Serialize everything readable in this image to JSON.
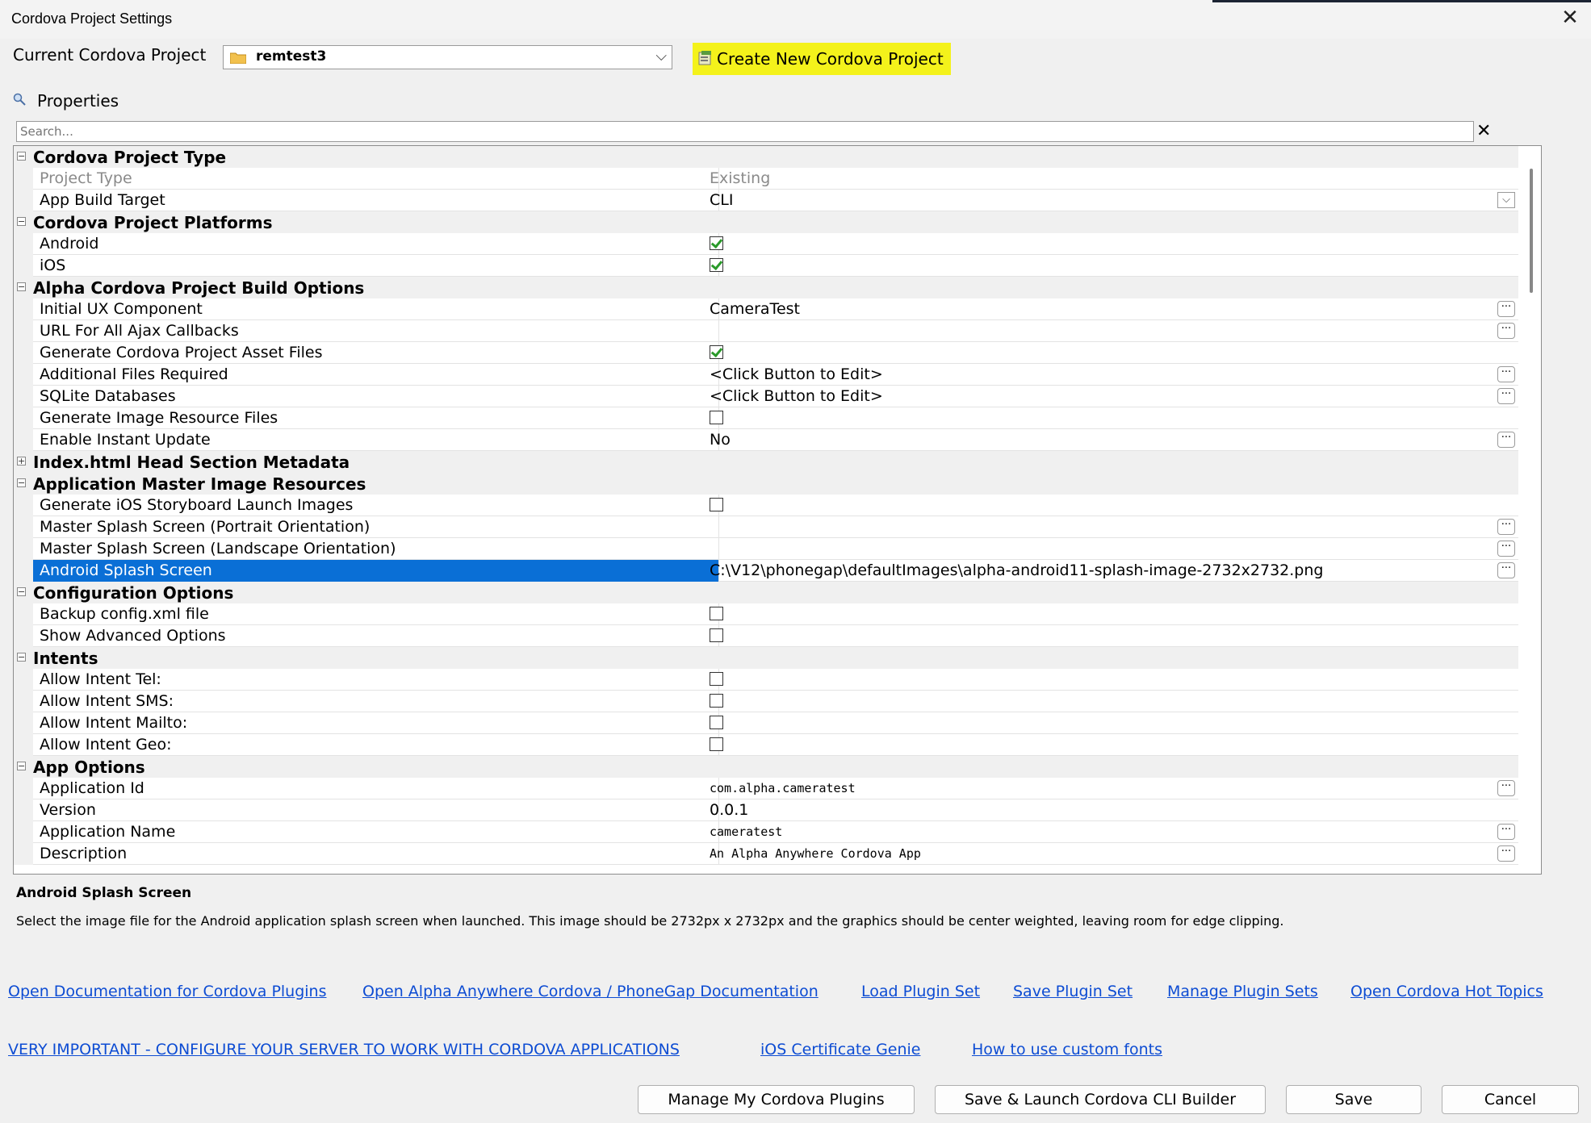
{
  "window": {
    "title": "Cordova Project Settings"
  },
  "project": {
    "label": "Current Cordova Project",
    "selected": "remtest3",
    "create_button": "Create New Cordova Project"
  },
  "properties": {
    "heading": "Properties",
    "search_placeholder": "Search..."
  },
  "grid": {
    "rows": [
      {
        "type": "cat",
        "name": "Cordova Project Type",
        "expanded": true
      },
      {
        "type": "prop",
        "name": "Project Type",
        "value": "Existing",
        "dim": true
      },
      {
        "type": "prop",
        "name": "App Build Target",
        "value": "CLI",
        "dropdown": true
      },
      {
        "type": "cat",
        "name": "Cordova Project Platforms",
        "expanded": true
      },
      {
        "type": "prop",
        "name": "Android",
        "check": true,
        "checked": true
      },
      {
        "type": "prop",
        "name": "iOS",
        "check": true,
        "checked": true
      },
      {
        "type": "cat",
        "name": "Alpha Cordova Project Build Options",
        "expanded": true
      },
      {
        "type": "prop",
        "name": "Initial UX Component",
        "value": "CameraTest",
        "ellipsis": true
      },
      {
        "type": "prop",
        "name": "URL For All Ajax Callbacks",
        "value": "",
        "ellipsis": true
      },
      {
        "type": "prop",
        "name": "Generate Cordova Project Asset Files",
        "check": true,
        "checked": true
      },
      {
        "type": "prop",
        "name": "Additional Files Required",
        "value": "<Click Button to Edit>",
        "ellipsis": true
      },
      {
        "type": "prop",
        "name": "SQLite Databases",
        "value": "<Click Button to Edit>",
        "ellipsis": true
      },
      {
        "type": "prop",
        "name": "Generate Image Resource Files",
        "check": true,
        "checked": false
      },
      {
        "type": "prop",
        "name": "Enable Instant Update",
        "value": "No",
        "ellipsis": true
      },
      {
        "type": "cat",
        "name": "Index.html Head Section Metadata",
        "expanded": false
      },
      {
        "type": "cat",
        "name": "Application Master Image Resources",
        "expanded": true
      },
      {
        "type": "prop",
        "name": "Generate iOS Storyboard Launch Images",
        "check": true,
        "checked": false
      },
      {
        "type": "prop",
        "name": "Master Splash Screen (Portrait Orientation)",
        "value": "",
        "ellipsis": true
      },
      {
        "type": "prop",
        "name": "Master Splash Screen (Landscape Orientation)",
        "value": "",
        "ellipsis": true
      },
      {
        "type": "prop",
        "name": "Android Splash Screen",
        "value": "C:\\V12\\phonegap\\defaultImages\\alpha-android11-splash-image-2732x2732.png",
        "ellipsis": true,
        "selected": true
      },
      {
        "type": "cat",
        "name": "Configuration Options",
        "expanded": true
      },
      {
        "type": "prop",
        "name": "Backup config.xml file",
        "check": true,
        "checked": false
      },
      {
        "type": "prop",
        "name": "Show Advanced Options",
        "check": true,
        "checked": false
      },
      {
        "type": "cat",
        "name": "Intents",
        "expanded": true
      },
      {
        "type": "prop",
        "name": "Allow Intent Tel:",
        "check": true,
        "checked": false
      },
      {
        "type": "prop",
        "name": "Allow Intent SMS:",
        "check": true,
        "checked": false
      },
      {
        "type": "prop",
        "name": "Allow Intent Mailto:",
        "check": true,
        "checked": false
      },
      {
        "type": "prop",
        "name": "Allow Intent Geo:",
        "check": true,
        "checked": false
      },
      {
        "type": "cat",
        "name": "App Options",
        "expanded": true
      },
      {
        "type": "prop",
        "name": "Application Id",
        "value": "com.alpha.cameratest",
        "ellipsis": true,
        "mono": true
      },
      {
        "type": "prop",
        "name": "Version",
        "value": "0.0.1"
      },
      {
        "type": "prop",
        "name": "Application Name",
        "value": "cameratest",
        "ellipsis": true,
        "mono": true
      },
      {
        "type": "prop",
        "name": "Description",
        "value": "An Alpha Anywhere Cordova App",
        "ellipsis": true,
        "mono": true
      }
    ]
  },
  "description": {
    "title": "Android Splash Screen",
    "text": "Select the image file for the Android application splash screen when launched. This image should be 2732px x 2732px and the graphics should be center weighted, leaving room for edge clipping."
  },
  "links": {
    "open_plugins_docs": "Open Documentation for Cordova Plugins",
    "open_phonegap_docs": "Open Alpha Anywhere Cordova / PhoneGap Documentation",
    "load_plugin_set": "Load Plugin Set",
    "save_plugin_set": "Save Plugin Set",
    "manage_plugin_sets": "Manage Plugin Sets",
    "hot_topics": "Open Cordova Hot Topics",
    "configure_server": "VERY IMPORTANT  - CONFIGURE YOUR SERVER TO WORK WITH CORDOVA APPLICATIONS",
    "ios_genie": "iOS Certificate Genie",
    "custom_fonts": "How to use custom fonts"
  },
  "buttons": {
    "manage_plugins": "Manage My Cordova Plugins",
    "save_launch": "Save & Launch Cordova CLI Builder",
    "save": "Save",
    "cancel": "Cancel"
  }
}
